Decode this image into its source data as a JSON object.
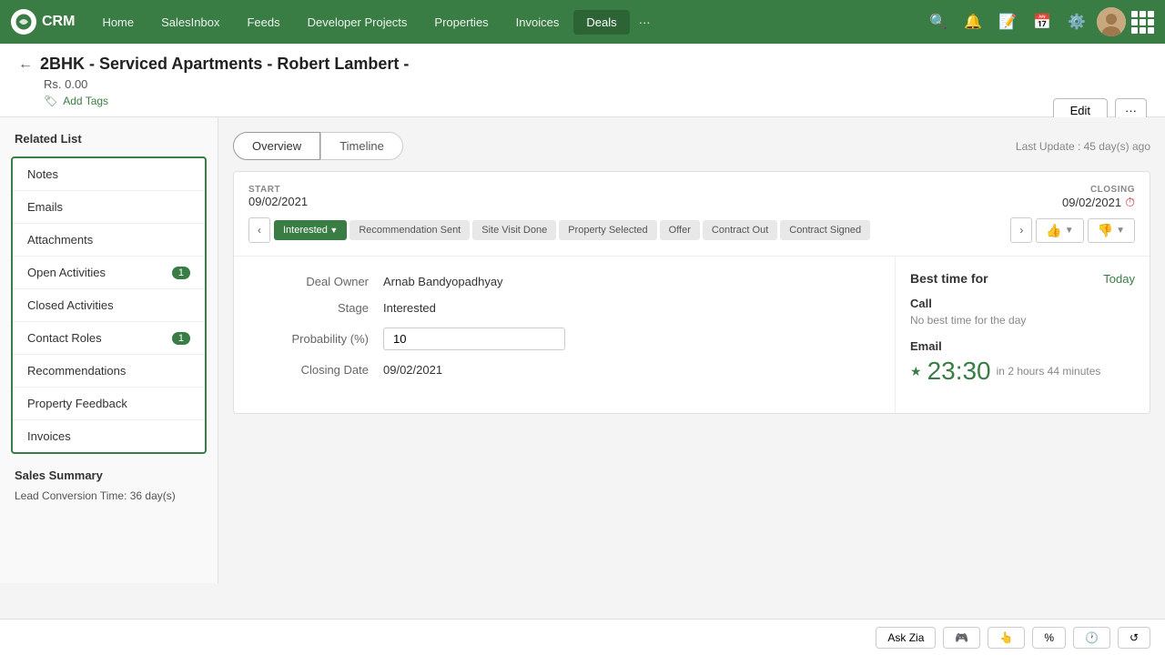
{
  "nav": {
    "logo_text": "CRM",
    "items": [
      {
        "label": "Home",
        "active": false
      },
      {
        "label": "SalesInbox",
        "active": false
      },
      {
        "label": "Feeds",
        "active": false
      },
      {
        "label": "Developer Projects",
        "active": false
      },
      {
        "label": "Properties",
        "active": false
      },
      {
        "label": "Invoices",
        "active": false
      },
      {
        "label": "Deals",
        "active": true
      }
    ],
    "more_label": "···"
  },
  "header": {
    "title": "2BHK - Serviced Apartments - Robert Lambert -",
    "subtitle": "Rs. 0.00",
    "add_tags_label": "Add Tags",
    "edit_label": "Edit",
    "more_label": "···"
  },
  "sidebar": {
    "related_list_label": "Related List",
    "items": [
      {
        "label": "Notes",
        "badge": null
      },
      {
        "label": "Emails",
        "badge": null
      },
      {
        "label": "Attachments",
        "badge": null
      },
      {
        "label": "Open Activities",
        "badge": "1"
      },
      {
        "label": "Closed Activities",
        "badge": null
      },
      {
        "label": "Contact Roles",
        "badge": "1"
      },
      {
        "label": "Recommendations",
        "badge": null
      },
      {
        "label": "Property Feedback",
        "badge": null
      },
      {
        "label": "Invoices",
        "badge": null
      }
    ],
    "sales_summary_label": "Sales Summary",
    "lead_conv_label": "Lead Conversion Time: 36 day(s)"
  },
  "content": {
    "tabs": [
      {
        "label": "Overview",
        "active": true
      },
      {
        "label": "Timeline",
        "active": false
      }
    ],
    "last_update": "Last Update : 45 day(s) ago",
    "start_label": "START",
    "start_date": "09/02/2021",
    "closing_label": "CLOSING",
    "closing_date": "09/02/2021",
    "pipeline_stages": [
      {
        "label": "Interested",
        "active": true
      },
      {
        "label": "Recommendation Sent",
        "active": false
      },
      {
        "label": "Site Visit Done",
        "active": false
      },
      {
        "label": "Property Selected",
        "active": false
      },
      {
        "label": "Offer",
        "active": false
      },
      {
        "label": "Contract Out",
        "active": false
      },
      {
        "label": "Contract Signed",
        "active": false
      }
    ],
    "fields": {
      "deal_owner_label": "Deal Owner",
      "deal_owner_value": "Arnab Bandyopadhyay",
      "stage_label": "Stage",
      "stage_value": "Interested",
      "probability_label": "Probability (%)",
      "probability_value": "10",
      "closing_date_label": "Closing Date",
      "closing_date_value": "09/02/2021"
    },
    "best_time": {
      "title": "Best time for",
      "today_label": "Today",
      "call_label": "Call",
      "call_sub": "No best time for the day",
      "email_label": "Email",
      "email_time": "23:30",
      "email_relative": "in 2 hours 44 minutes"
    }
  },
  "toolbar": {
    "ask_zia": "Ask Zia"
  }
}
